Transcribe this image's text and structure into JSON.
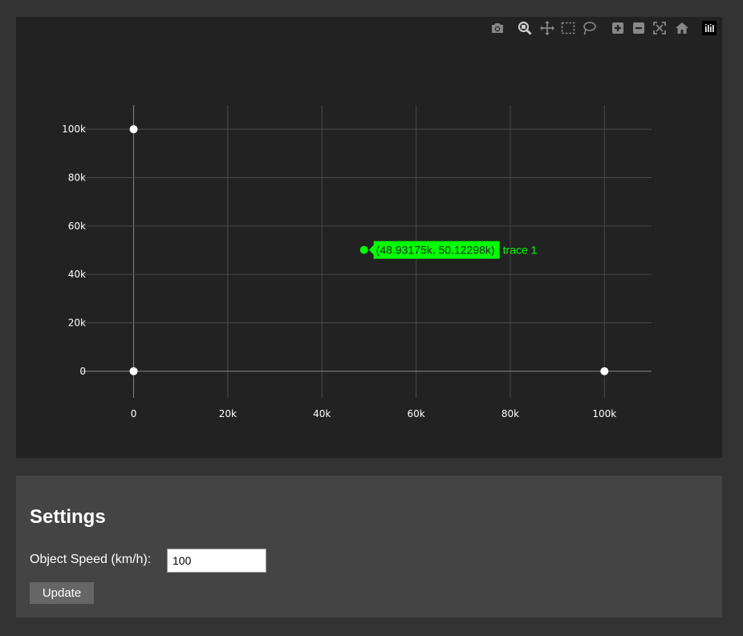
{
  "plot": {
    "modebar": [
      {
        "name": "camera-icon",
        "title": "Download plot as a png"
      },
      {
        "name": "zoom-icon",
        "title": "Zoom"
      },
      {
        "name": "pan-icon",
        "title": "Pan"
      },
      {
        "name": "box-select-icon",
        "title": "Box Select"
      },
      {
        "name": "lasso-select-icon",
        "title": "Lasso Select"
      },
      {
        "name": "zoom-in-icon",
        "title": "Zoom in"
      },
      {
        "name": "zoom-out-icon",
        "title": "Zoom out"
      },
      {
        "name": "autoscale-icon",
        "title": "Autoscale"
      },
      {
        "name": "reset-axes-icon",
        "title": "Reset axes"
      },
      {
        "name": "plotly-logo-icon",
        "title": "Produced with Plotly"
      }
    ],
    "colors": {
      "panel_bg": "#222222",
      "grid": "#4a4a4a",
      "zeroline": "#888888",
      "point_default": "#ffffff",
      "point_highlight": "#00ff00",
      "icon": "#888888",
      "icon_active": "#cccccc"
    }
  },
  "chart_data": {
    "type": "scatter",
    "xlim": [
      -11000,
      110000
    ],
    "ylim": [
      -11000,
      110000
    ],
    "xticks": [
      0,
      20000,
      40000,
      60000,
      80000,
      100000
    ],
    "xtick_labels": [
      "0",
      "20k",
      "40k",
      "60k",
      "80k",
      "100k"
    ],
    "yticks": [
      0,
      20000,
      40000,
      60000,
      80000,
      100000
    ],
    "ytick_labels": [
      "0",
      "20k",
      "40k",
      "60k",
      "80k",
      "100k"
    ],
    "grid": true,
    "series": [
      {
        "points": [
          {
            "x": 0,
            "y": 100000
          },
          {
            "x": 0,
            "y": 0
          },
          {
            "x": 100000,
            "y": 0
          }
        ],
        "color": "#ffffff"
      },
      {
        "name": "trace 1",
        "points": [
          {
            "x": 48931.75,
            "y": 50122.98
          }
        ],
        "color": "#00ff00"
      }
    ],
    "hover": {
      "label": "(48.93175k, 50.12298k)",
      "trace_name": "trace 1"
    }
  },
  "settings": {
    "title": "Settings",
    "speed_label": "Object Speed (km/h):",
    "speed_value": "100",
    "update_label": "Update"
  }
}
